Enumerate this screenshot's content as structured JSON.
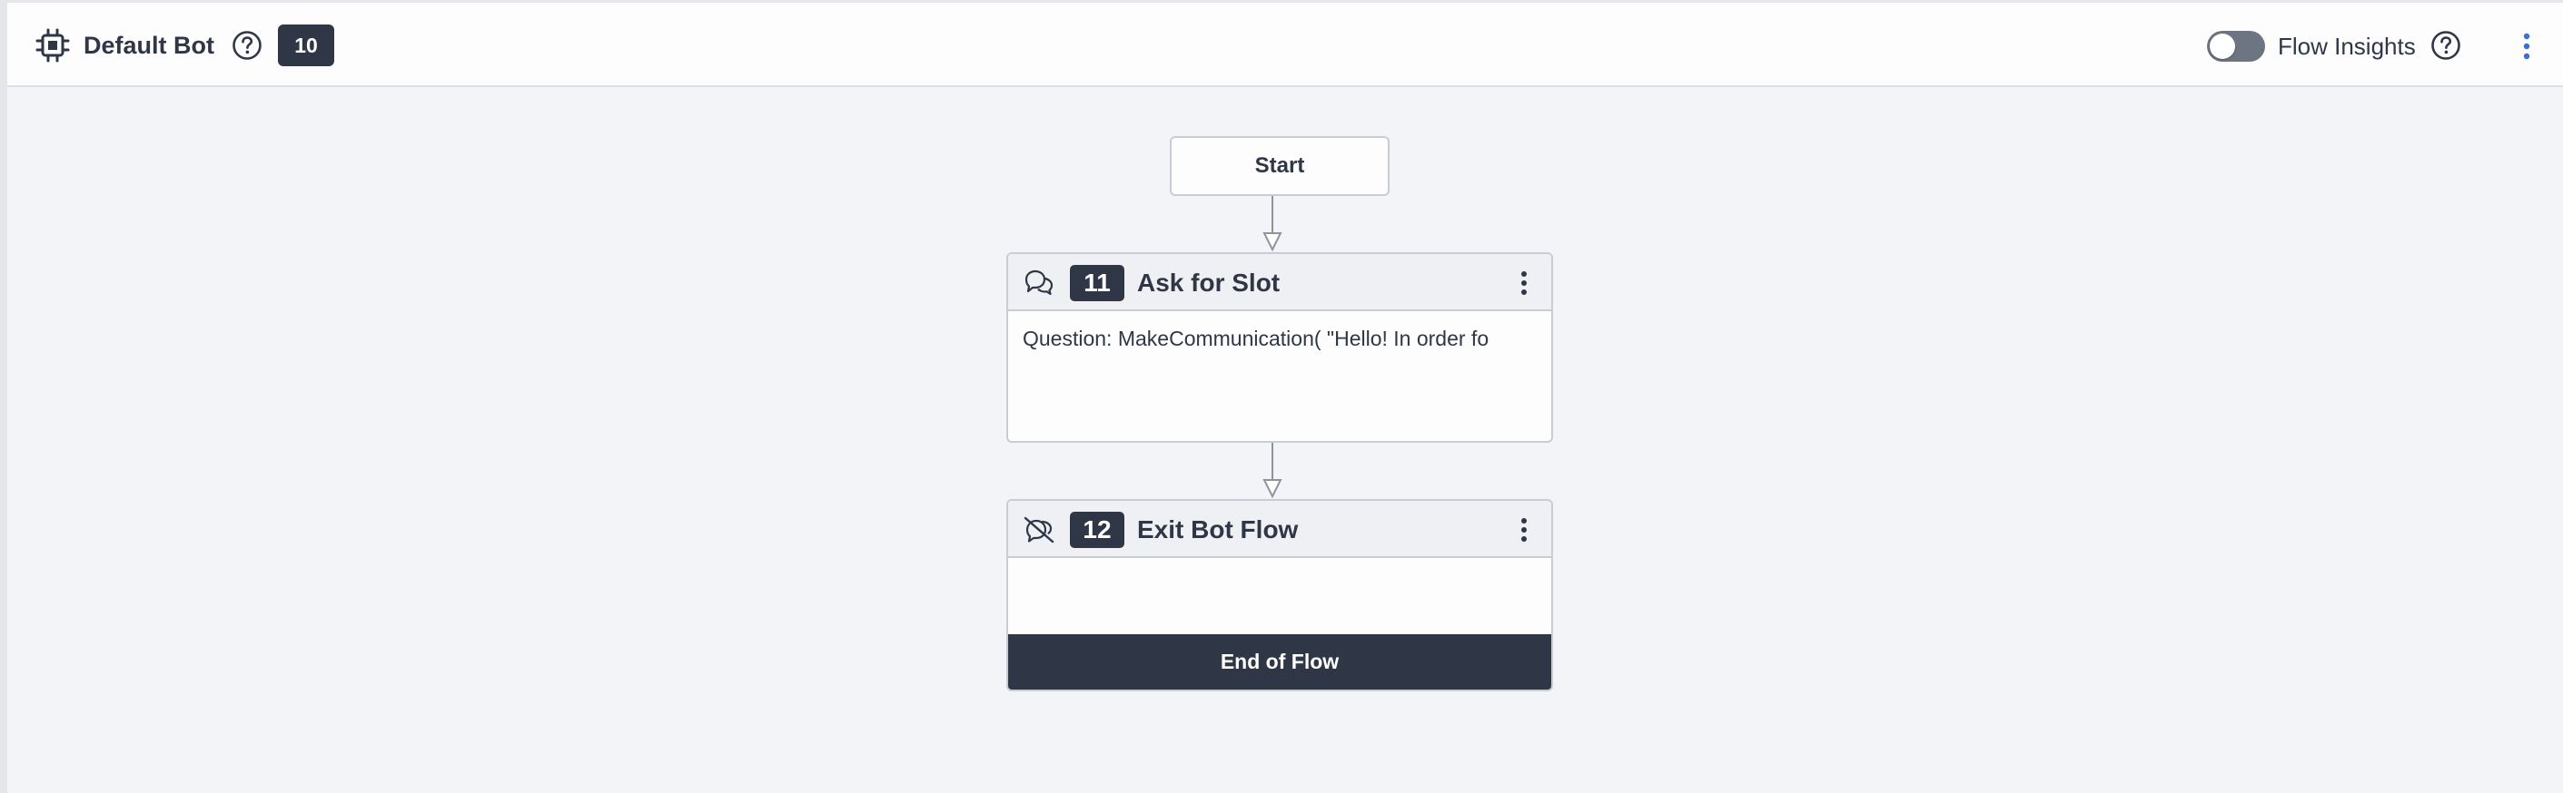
{
  "header": {
    "bot_name": "Default Bot",
    "bot_icon": "chip-icon",
    "bot_id": "10",
    "help_icon": "question-circle-icon",
    "insights_label": "Flow Insights",
    "insights_enabled": false,
    "menu_icon": "kebab-menu-icon"
  },
  "flow": {
    "start_label": "Start",
    "nodes": [
      {
        "id": "11",
        "title": "Ask for Slot",
        "icon": "chat-bubbles-icon",
        "body": "Question: MakeCommunication( \"Hello! In order fo"
      },
      {
        "id": "12",
        "title": "Exit Bot Flow",
        "icon": "exit-flow-icon",
        "body": "",
        "footer": "End of Flow"
      }
    ]
  },
  "colors": {
    "dark": "#2f3747",
    "canvas": "#f3f4f8",
    "node_header": "#eef0f4",
    "border": "#c9ccd3",
    "toggle_off": "#6d7482"
  }
}
